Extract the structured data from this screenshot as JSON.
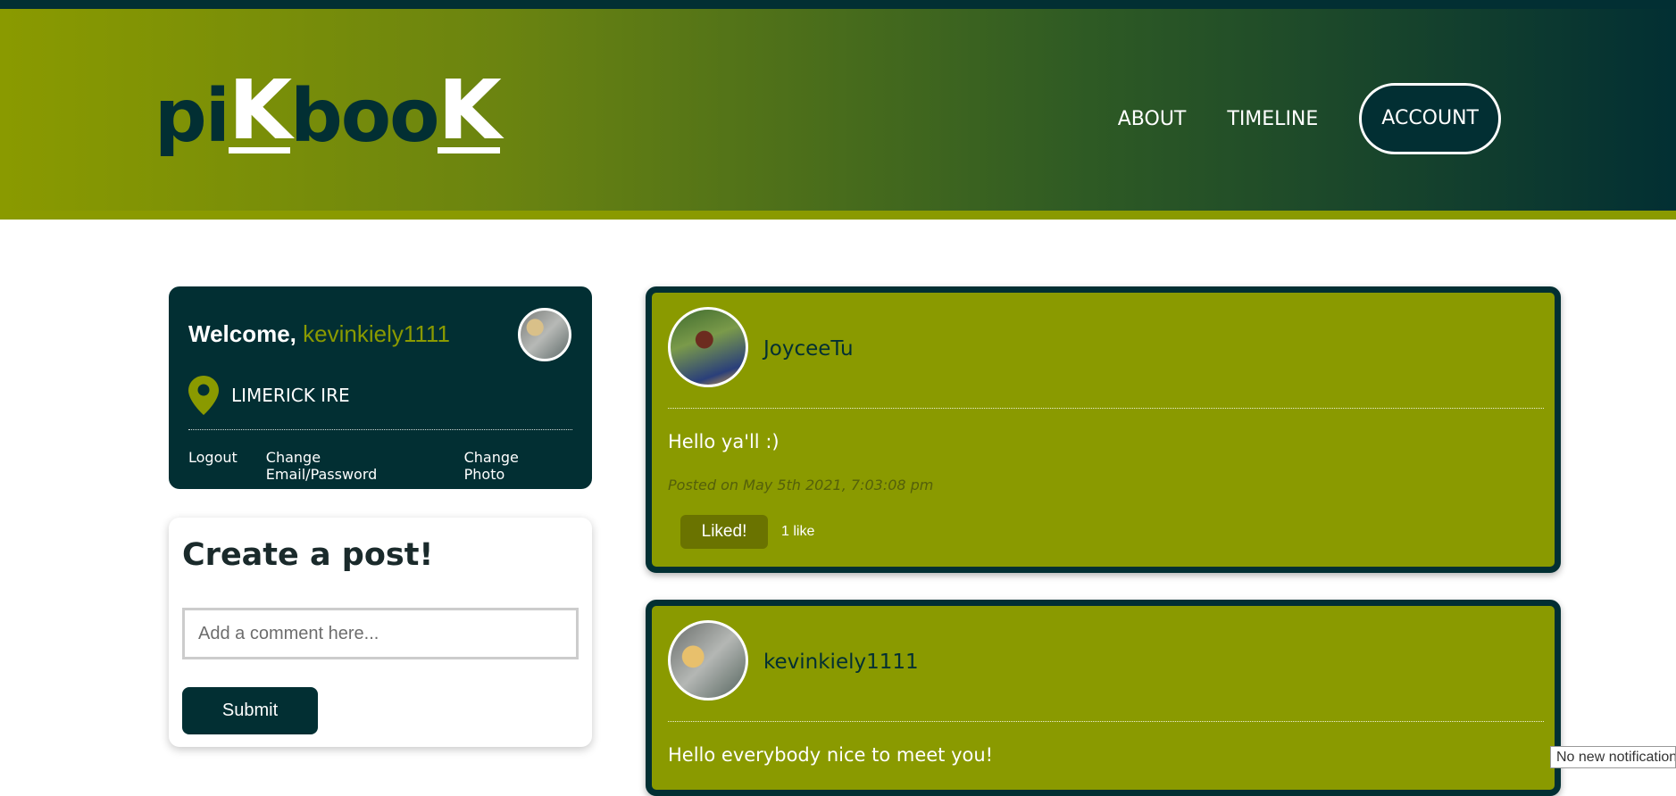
{
  "brand": {
    "logo_parts": [
      "pi",
      "K",
      "boo",
      "K"
    ]
  },
  "nav": {
    "about": "ABOUT",
    "timeline": "TIMELINE",
    "account": "ACCOUNT"
  },
  "profile": {
    "welcome": "Welcome,",
    "username": "kevinkiely1111",
    "location": "LIMERICK IRE",
    "links": {
      "logout": "Logout",
      "change_email": "Change Email/Password",
      "change_photo": "Change Photo"
    }
  },
  "create_post": {
    "title": "Create a post!",
    "placeholder": "Add a comment here...",
    "value": "",
    "submit": "Submit"
  },
  "posts": [
    {
      "user": "JoyceeTu",
      "text": "Hello ya'll :)",
      "date": "Posted on May 5th 2021, 7:03:08 pm",
      "like_label": "Liked!",
      "likes": "1 like"
    },
    {
      "user": "kevinkiely1111",
      "text": "Hello everybody nice to meet you!"
    }
  ],
  "notification": "No new notifications",
  "colors": {
    "dark": "#022f33",
    "olive": "#8a9a00",
    "white": "#ffffff"
  },
  "icons": {
    "location": "map-pin-icon"
  }
}
